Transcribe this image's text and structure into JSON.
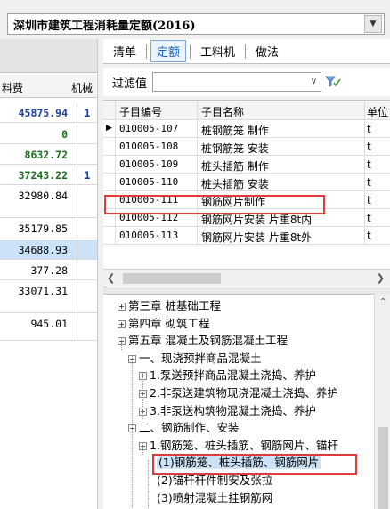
{
  "top_select": {
    "value": "深圳市建筑工程消耗量定额(2016)"
  },
  "left_table": {
    "columns": [
      "料费",
      "机械"
    ],
    "rows": [
      {
        "value": "45875.94",
        "extra": "1",
        "style": "blue"
      },
      {
        "value": "0",
        "extra": "",
        "style": "green"
      },
      {
        "value": "8632.72",
        "extra": "",
        "style": "green"
      },
      {
        "value": "37243.22",
        "extra": "1",
        "style": "green"
      },
      {
        "value": "32980.84",
        "extra": "",
        "style": ""
      },
      {
        "value": "35179.85",
        "extra": "",
        "style": ""
      },
      {
        "value": "34688.93",
        "extra": "",
        "style": "sel"
      },
      {
        "value": "377.28",
        "extra": "",
        "style": ""
      },
      {
        "value": "33071.31",
        "extra": "",
        "style": ""
      },
      {
        "value": "945.01",
        "extra": "",
        "style": ""
      }
    ]
  },
  "tabs": [
    {
      "label": "清单",
      "active": false
    },
    {
      "label": "定额",
      "active": true
    },
    {
      "label": "工料机",
      "active": false
    },
    {
      "label": "做法",
      "active": false
    }
  ],
  "filter": {
    "label": "过滤值",
    "value": ""
  },
  "grid": {
    "headers": [
      "子目编号",
      "子目名称",
      "单位"
    ],
    "rows": [
      {
        "code": "010005-107",
        "name": "桩钢筋笼 制作",
        "unit": "t",
        "current": true
      },
      {
        "code": "010005-108",
        "name": "桩钢筋笼 安装",
        "unit": "t",
        "current": false
      },
      {
        "code": "010005-109",
        "name": "桩头插筋 制作",
        "unit": "t",
        "current": false
      },
      {
        "code": "010005-110",
        "name": "桩头插筋 安装",
        "unit": "t",
        "current": false
      },
      {
        "code": "010005-111",
        "name": "钢筋网片制作",
        "unit": "t",
        "current": false
      },
      {
        "code": "010005-112",
        "name": "钢筋网片安装 片重8t内",
        "unit": "t",
        "current": false
      },
      {
        "code": "010005-113",
        "name": "钢筋网片安装 片重8t外",
        "unit": "t",
        "current": false
      }
    ]
  },
  "tree": [
    {
      "label": "第三章 桩基础工程",
      "box": "+",
      "level": 0
    },
    {
      "label": "第四章 砌筑工程",
      "box": "+",
      "level": 0
    },
    {
      "label": "第五章 混凝土及钢筋混凝土工程",
      "box": "-",
      "level": 0
    },
    {
      "label": "一、现浇预拌商品混凝土",
      "box": "-",
      "level": 1
    },
    {
      "label": "1.泵送预拌商品混凝土浇捣、养护",
      "box": "+",
      "level": 2
    },
    {
      "label": "2.非泵送建筑物现浇混凝土浇捣、养护",
      "box": "+",
      "level": 2
    },
    {
      "label": "3.非泵送构筑物混凝土浇捣、养护",
      "box": "+",
      "level": 2
    },
    {
      "label": "二、钢筋制作、安装",
      "box": "-",
      "level": 1
    },
    {
      "label": "1.钢筋笼、桩头插筋、钢筋网片、锚杆",
      "box": "-",
      "level": 2
    },
    {
      "label": "(1)钢筋笼、桩头插筋、钢筋网片",
      "box": "",
      "level": 3,
      "selected": true
    },
    {
      "label": "(2)锚杆杆件制安及张拉",
      "box": "",
      "level": 3
    },
    {
      "label": "(3)喷射混凝土挂钢筋网",
      "box": "",
      "level": 3
    }
  ],
  "colors": {
    "highlight": "#e03a3a",
    "selection": "#cce3f7",
    "tab_active": "#1a5fb4"
  }
}
